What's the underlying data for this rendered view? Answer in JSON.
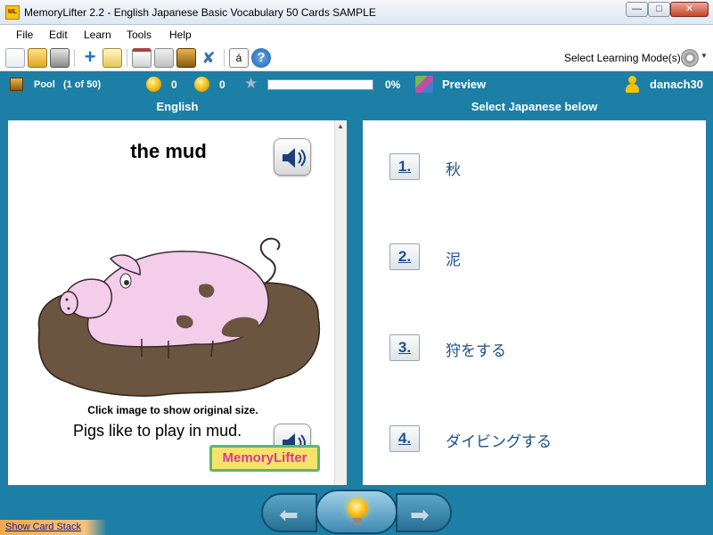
{
  "window": {
    "title": "MemoryLifter 2.2 - English Japanese Basic Vocabulary 50 Cards SAMPLE",
    "app_icon_text": "ML"
  },
  "menu": {
    "items": [
      "File",
      "Edit",
      "Learn",
      "Tools",
      "Help"
    ]
  },
  "toolbar": {
    "icons": [
      "new-icon",
      "open-icon",
      "print-icon",
      "add-card-icon",
      "edit-icon",
      "presentation-icon",
      "statistics-icon",
      "card-box-icon",
      "settings-tools-icon",
      "character-map-icon",
      "help-icon"
    ],
    "select_mode_label": "Select Learning Mode(s)"
  },
  "status": {
    "pool_label": "Pool",
    "pool_count": "(1 of 50)",
    "right_count": "0",
    "wrong_count": "0",
    "progress_percent": 0,
    "progress_text": "0%",
    "preview_label": "Preview",
    "user": "danach30"
  },
  "headers": {
    "question": "English",
    "answer": "Select Japanese below"
  },
  "card": {
    "word": "the mud",
    "image_caption": "Click image to show original size.",
    "example_sentence": "Pigs like to play in mud.",
    "logo_text": "MemoryLifter"
  },
  "answers": [
    {
      "num": "1.",
      "text": "秋"
    },
    {
      "num": "2.",
      "text": "泥"
    },
    {
      "num": "3.",
      "text": "狩をする"
    },
    {
      "num": "4.",
      "text": "ダイビングする"
    }
  ],
  "bottom": {
    "show_card_stack": "Show Card Stack"
  },
  "colors": {
    "background_blue": "#1d7fa6",
    "answer_text": "#1f4f88",
    "pig_pink": "#f4cdea",
    "mud_brown": "#6b5540"
  }
}
